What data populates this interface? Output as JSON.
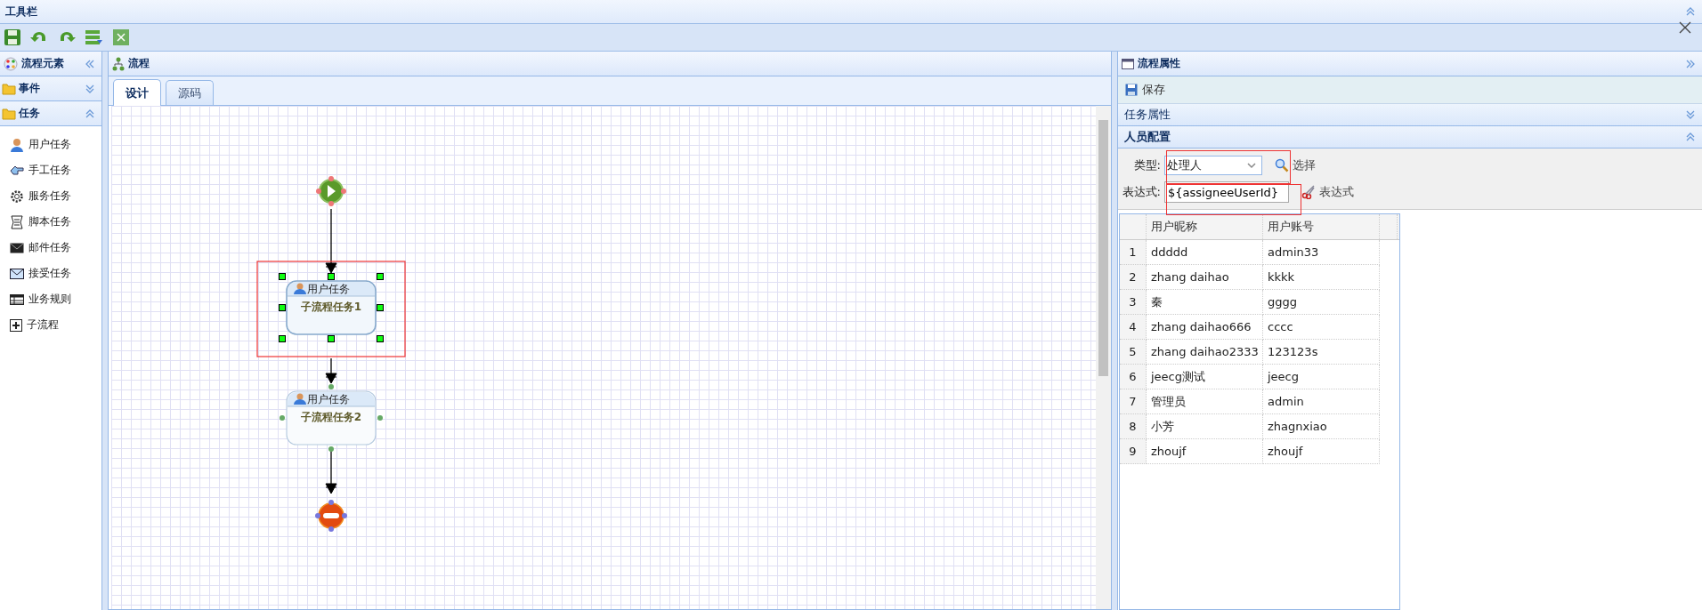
{
  "toolbar": {
    "title": "工具栏"
  },
  "elements_panel": {
    "title": "流程元素",
    "groups": [
      {
        "label": "事件",
        "expanded": false
      },
      {
        "label": "任务",
        "expanded": true,
        "items": [
          {
            "label": "用户任务",
            "kind": "user"
          },
          {
            "label": "手工任务",
            "kind": "manual"
          },
          {
            "label": "服务任务",
            "kind": "service"
          },
          {
            "label": "脚本任务",
            "kind": "script"
          },
          {
            "label": "邮件任务",
            "kind": "mail"
          },
          {
            "label": "接受任务",
            "kind": "receive"
          },
          {
            "label": "业务规则",
            "kind": "rule"
          },
          {
            "label": "子流程",
            "kind": "subprocess"
          }
        ]
      }
    ]
  },
  "process_panel": {
    "title": "流程",
    "tabs": [
      {
        "label": "设计",
        "selected": true
      },
      {
        "label": "源码",
        "selected": false
      }
    ],
    "nodes": [
      {
        "kind": "start"
      },
      {
        "kind": "task",
        "type_label": "用户任务",
        "name": "子流程任务1",
        "selected": true
      },
      {
        "kind": "task",
        "type_label": "用户任务",
        "name": "子流程任务2",
        "selected": false
      },
      {
        "kind": "end"
      }
    ]
  },
  "properties_panel": {
    "title": "流程属性",
    "save_label": "保存",
    "sections": [
      {
        "label": "任务属性",
        "expanded": false
      },
      {
        "label": "人员配置",
        "expanded": true
      }
    ],
    "form": {
      "type_label": "类型:",
      "type_value": "处理人",
      "select_button": "选择",
      "expression_label": "表达式:",
      "expression_value": "${assigneeUserId}",
      "expression_button": "表达式",
      "highlighted": true
    },
    "table": {
      "columns": [
        "用户昵称",
        "用户账号"
      ],
      "rows": [
        {
          "num": "1",
          "nickname": "ddddd",
          "account": "admin33"
        },
        {
          "num": "2",
          "nickname": "zhang daihao",
          "account": "kkkk"
        },
        {
          "num": "3",
          "nickname": "秦",
          "account": "gggg"
        },
        {
          "num": "4",
          "nickname": "zhang daihao666",
          "account": "cccc"
        },
        {
          "num": "5",
          "nickname": "zhang daihao2333",
          "account": "123123s"
        },
        {
          "num": "6",
          "nickname": "jeecg测试",
          "account": "jeecg"
        },
        {
          "num": "7",
          "nickname": "管理员",
          "account": "admin"
        },
        {
          "num": "8",
          "nickname": "小芳",
          "account": "zhagnxiao"
        },
        {
          "num": "9",
          "nickname": "zhoujf",
          "account": "zhoujf"
        }
      ]
    }
  }
}
